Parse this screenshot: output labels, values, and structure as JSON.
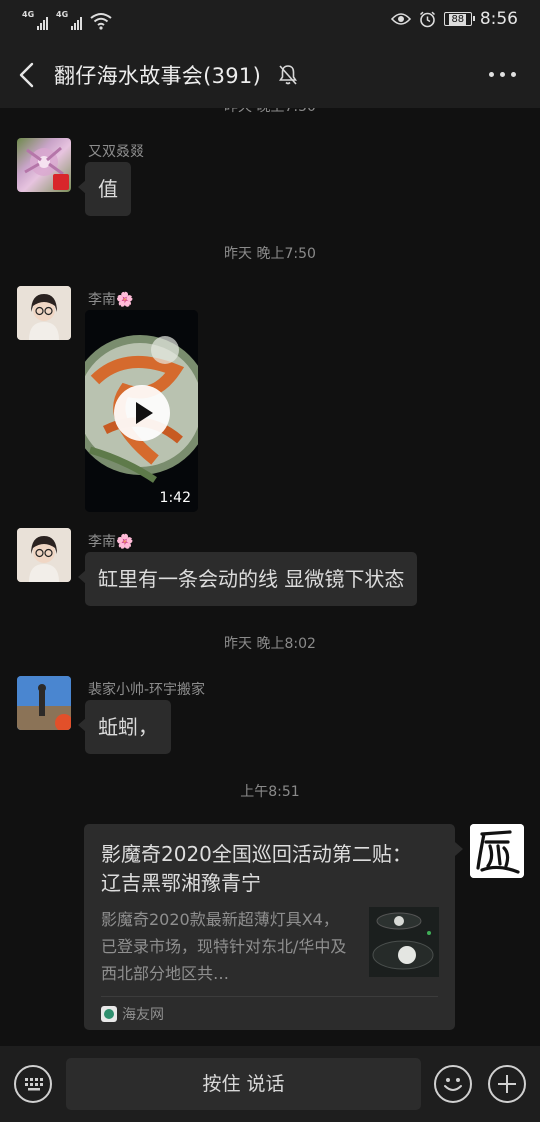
{
  "status_bar": {
    "signal_1_label": "4G",
    "signal_2_label": "4G",
    "battery_level": "88",
    "time": "8:56",
    "icons": [
      "signal-icon",
      "signal-icon",
      "wifi-icon",
      "eye-icon",
      "alarm-icon",
      "battery-icon"
    ]
  },
  "header": {
    "title": "翻仔海水故事会(391)",
    "icons": [
      "back-arrow-icon",
      "bell-muted-icon",
      "more-icon"
    ]
  },
  "chat": {
    "timestamps": [
      "昨天 晚上7:50",
      "昨天 晚上8:02",
      "上午8:51"
    ],
    "messages": [
      {
        "sender": "又双叒叕",
        "type": "text",
        "text": "值"
      },
      {
        "sender": "李南🌸",
        "type": "video",
        "duration": "1:42"
      },
      {
        "sender": "李南🌸",
        "type": "text",
        "text": "缸里有一条会动的线 显微镜下状态"
      },
      {
        "sender": "裴家小帅-环宇搬家",
        "type": "text",
        "text": "蚯蚓，"
      },
      {
        "sender": "",
        "type": "link",
        "outgoing": true,
        "title": "影魔奇2020全国巡回活动第二贴： 辽吉黑鄂湘豫青宁",
        "description": "影魔奇2020款最新超薄灯具X4，已登录市场，现特针对东北/华中及西北部分地区共…",
        "source": "海友网"
      }
    ]
  },
  "input_bar": {
    "hold_to_talk": "按住 说话",
    "icons": [
      "keyboard-icon",
      "emoji-icon",
      "plus-icon"
    ]
  },
  "colors": {
    "background": "#111111",
    "bar_background": "#1e1e1e",
    "bubble": "#2c2c2c"
  }
}
